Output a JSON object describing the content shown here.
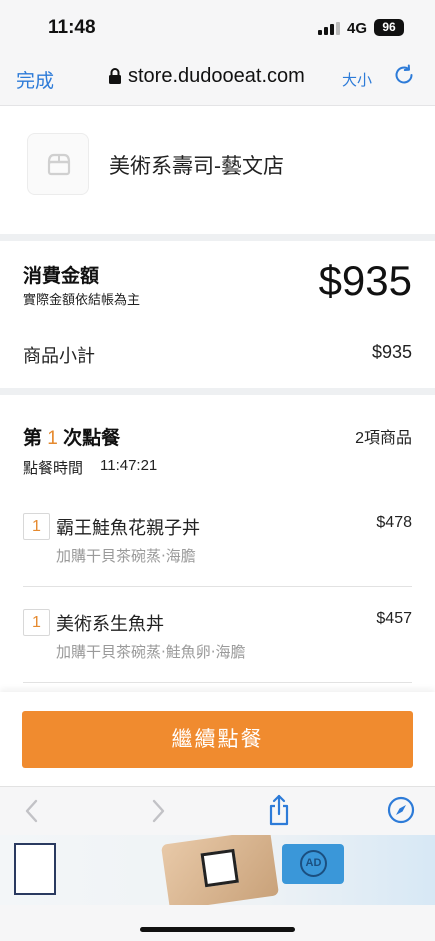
{
  "status_bar": {
    "time": "11:48",
    "network": "4G",
    "battery": "96"
  },
  "browser": {
    "done_label": "完成",
    "url": "store.dudooeat.com",
    "text_size_label": "大小"
  },
  "store": {
    "name": "美術系壽司-藝文店"
  },
  "amount": {
    "label": "消費金額",
    "note": "實際金額依結帳為主",
    "total": "$935",
    "subtotal_label": "商品小計",
    "subtotal": "$935"
  },
  "order": {
    "title_prefix": "第",
    "round": "1",
    "title_suffix": "次點餐",
    "item_count": "2項商品",
    "time_label": "點餐時間",
    "time": "11:47:21",
    "items": [
      {
        "qty": "1",
        "name": "霸王鮭魚花親子丼",
        "price": "$478",
        "addons": "加購干貝茶碗蒸‧海膽"
      },
      {
        "qty": "1",
        "name": "美術系生魚丼",
        "price": "$457",
        "addons": "加購干貝茶碗蒸‧鮭魚卵‧海膽"
      }
    ]
  },
  "cta": {
    "label": "繼續點餐"
  },
  "colors": {
    "accent": "#f08b2f",
    "link": "#2d7bd8",
    "separator": "#eef0f2"
  },
  "icons": [
    "lock-icon",
    "reload-icon",
    "back-icon",
    "forward-icon",
    "share-icon",
    "compass-icon",
    "store-logo-icon"
  ]
}
